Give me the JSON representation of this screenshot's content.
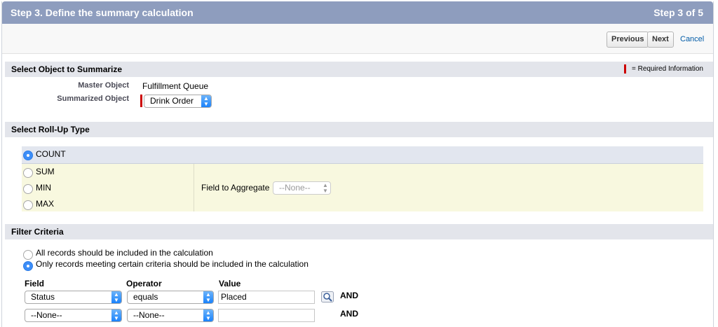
{
  "header": {
    "title": "Step 3. Define the summary calculation",
    "step": "Step 3 of 5"
  },
  "toolbar": {
    "previous": "Previous",
    "next": "Next",
    "cancel": "Cancel"
  },
  "object_section": {
    "title": "Select Object to Summarize",
    "required_legend": "= Required Information",
    "master_label": "Master Object",
    "master_value": "Fulfillment Queue",
    "summarized_label": "Summarized Object",
    "summarized_value": "Drink Order"
  },
  "rollup_section": {
    "title": "Select Roll-Up Type",
    "options": [
      "COUNT",
      "SUM",
      "MIN",
      "MAX"
    ],
    "selected": "COUNT",
    "field_label": "Field to Aggregate",
    "field_value": "--None--"
  },
  "filter_section": {
    "title": "Filter Criteria",
    "option_all": "All records should be included in the calculation",
    "option_some": "Only records meeting certain criteria should be included in the calculation",
    "col_field": "Field",
    "col_operator": "Operator",
    "col_value": "Value",
    "rows": [
      {
        "field": "Status",
        "operator": "equals",
        "value": "Placed",
        "conj": "AND"
      },
      {
        "field": "--None--",
        "operator": "--None--",
        "value": "",
        "conj": "AND"
      }
    ]
  },
  "colors": {
    "header_bg": "#8e9dbe",
    "section_bg": "#e3e5eb",
    "required": "#cc0000",
    "rollup_bg": "#f8f8df",
    "select_accent": "#1a82fb"
  }
}
